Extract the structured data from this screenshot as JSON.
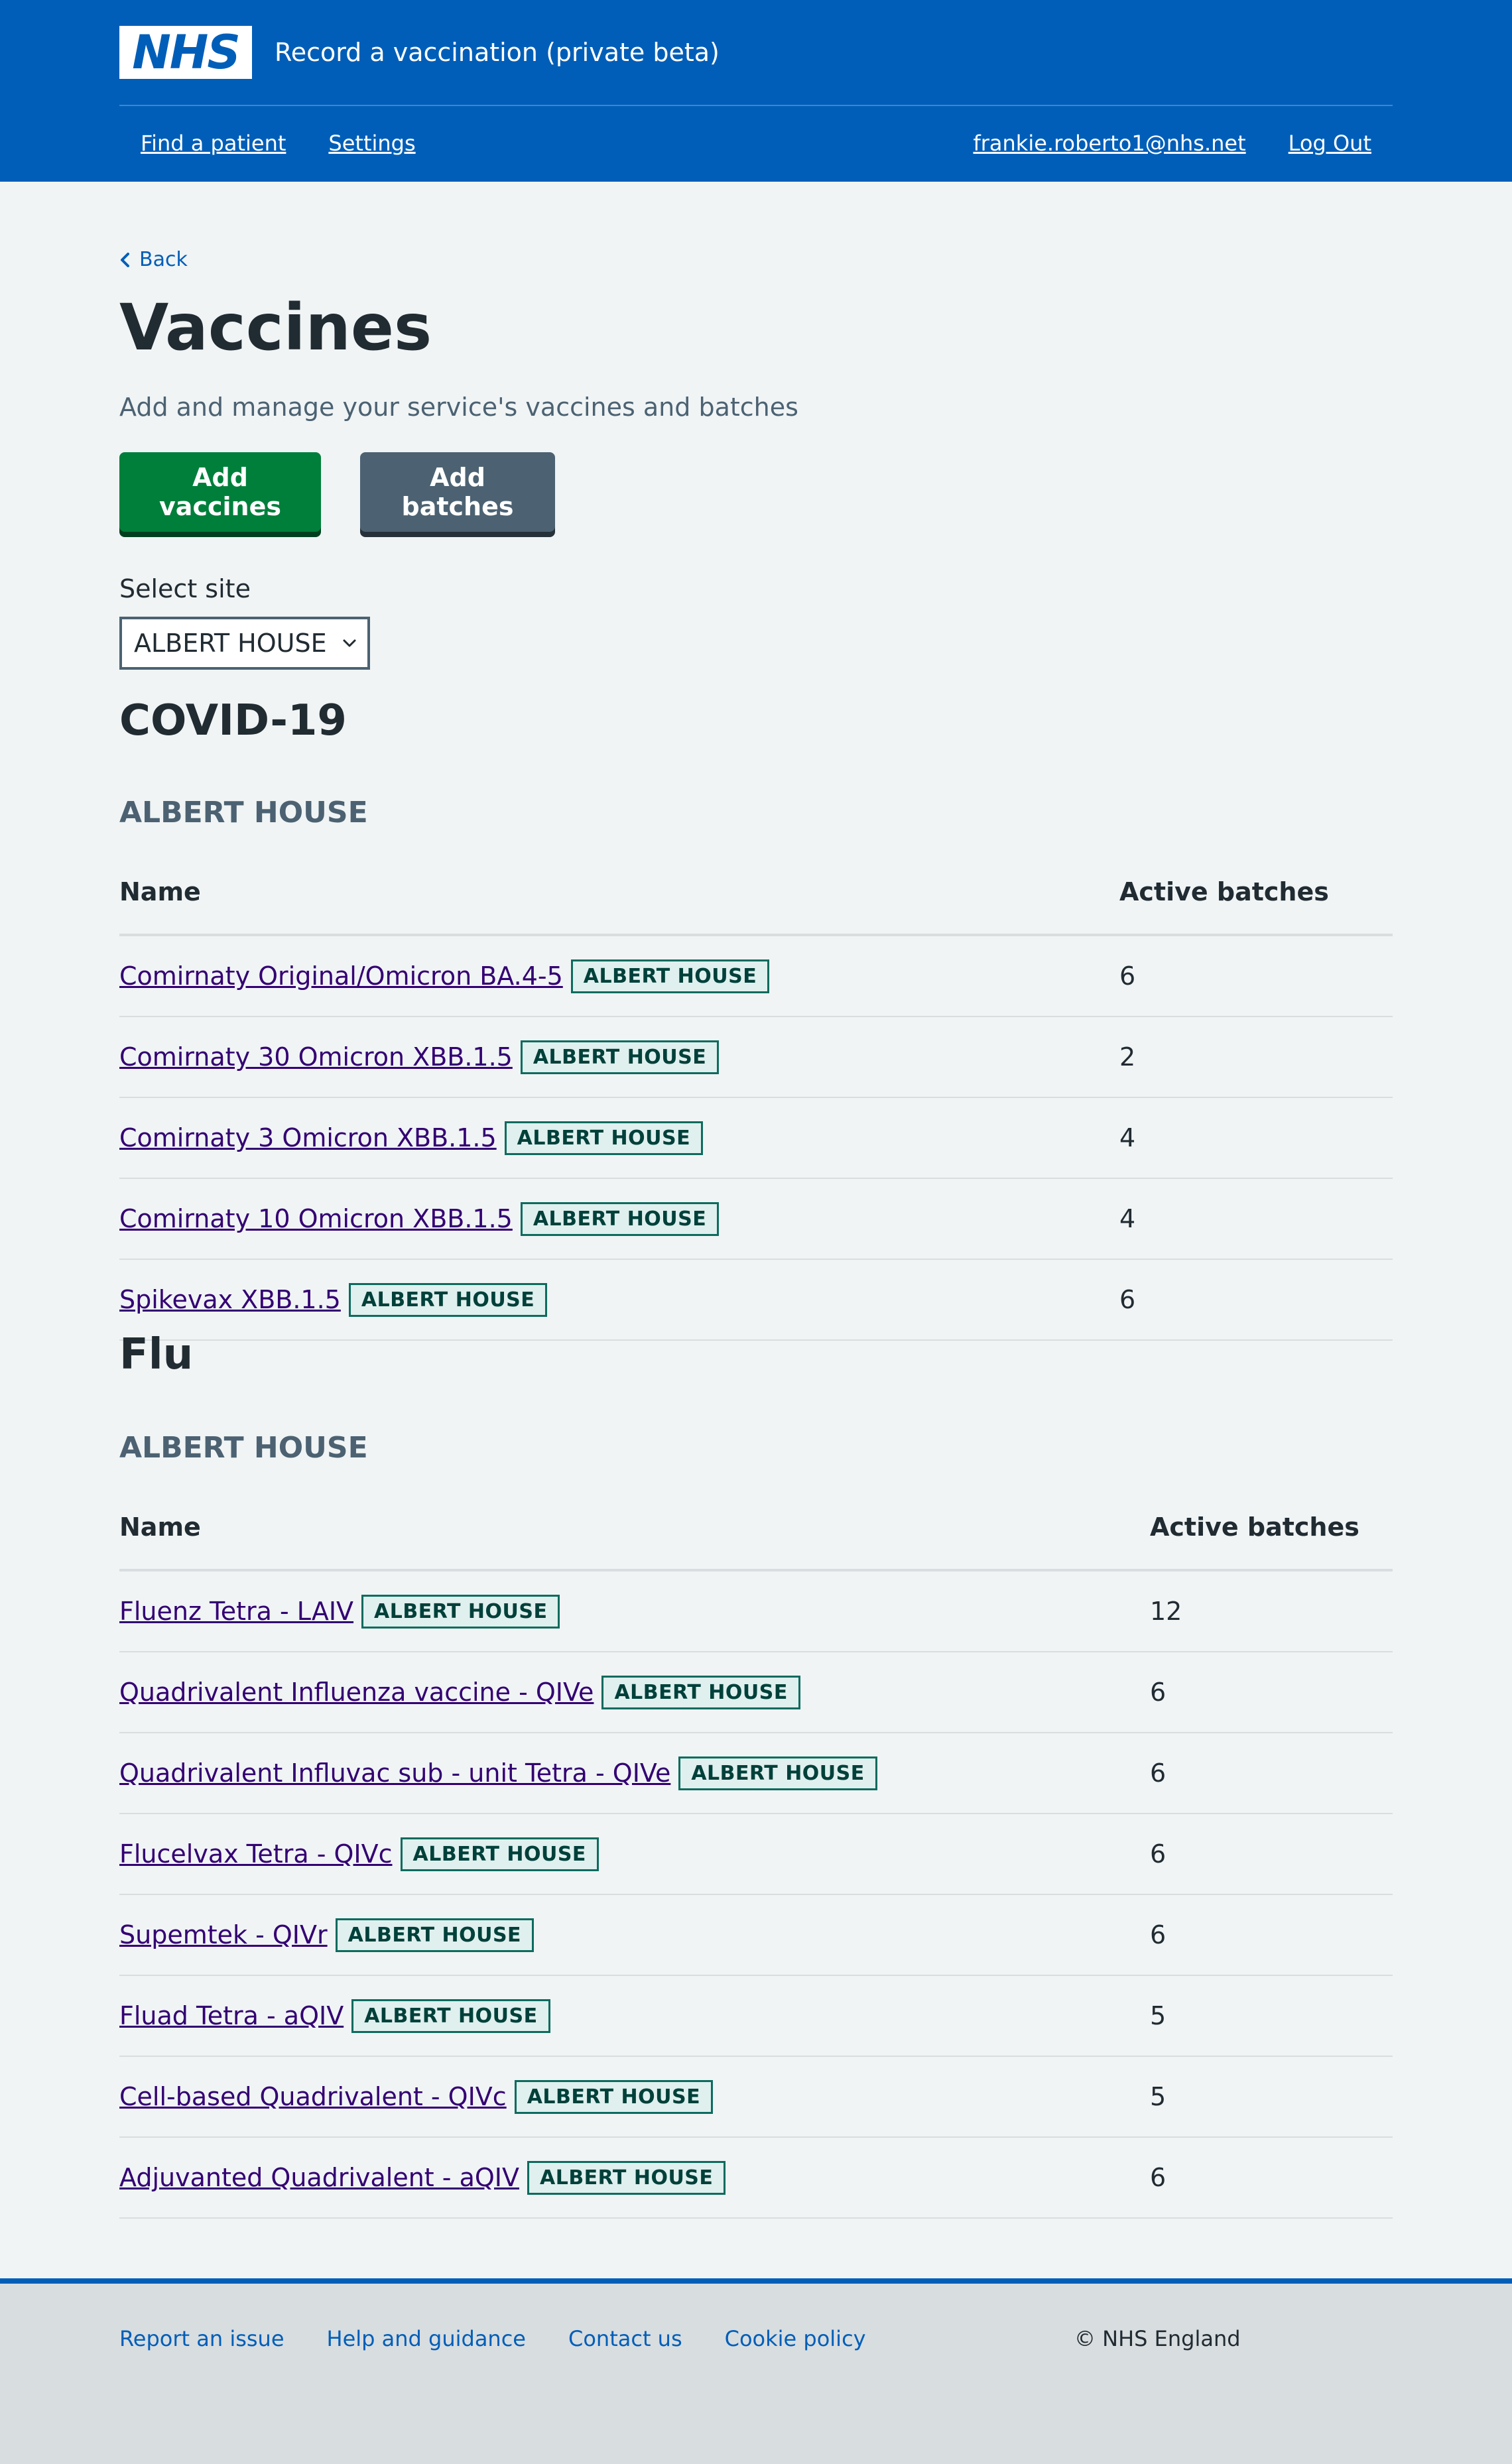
{
  "header": {
    "logo_text": "NHS",
    "service_name": "Record a vaccination (private beta)",
    "nav": {
      "find_patient": "Find a patient",
      "settings": "Settings",
      "user_email": "frankie.roberto1@nhs.net",
      "log_out": "Log Out"
    }
  },
  "page": {
    "back_label": "Back",
    "title": "Vaccines",
    "lede": "Add and manage your service's vaccines and batches",
    "add_vaccines_label": "Add vaccines",
    "add_batches_label": "Add batches",
    "select_site_label": "Select site",
    "selected_site": "ALBERT HOUSE"
  },
  "sections": {
    "covid": {
      "title": "COVID-19",
      "site_caption": "ALBERT HOUSE",
      "col_name": "Name",
      "col_batches": "Active batches",
      "rows": [
        {
          "name": "Comirnaty Original/Omicron BA.4-5",
          "tag": "ALBERT HOUSE",
          "batches": "6"
        },
        {
          "name": "Comirnaty 30 Omicron XBB.1.5",
          "tag": "ALBERT HOUSE",
          "batches": "2"
        },
        {
          "name": "Comirnaty 3 Omicron XBB.1.5",
          "tag": "ALBERT HOUSE",
          "batches": "4"
        },
        {
          "name": "Comirnaty 10 Omicron XBB.1.5",
          "tag": "ALBERT HOUSE",
          "batches": "4"
        },
        {
          "name": "Spikevax XBB.1.5",
          "tag": "ALBERT HOUSE",
          "batches": "6"
        }
      ]
    },
    "flu": {
      "title": "Flu",
      "site_caption": "ALBERT HOUSE",
      "col_name": "Name",
      "col_batches": "Active batches",
      "rows": [
        {
          "name": "Fluenz Tetra - LAIV",
          "tag": "ALBERT HOUSE",
          "batches": "12"
        },
        {
          "name": "Quadrivalent Influenza vaccine - QIVe",
          "tag": "ALBERT HOUSE",
          "batches": "6"
        },
        {
          "name": "Quadrivalent Influvac sub - unit Tetra - QIVe",
          "tag": "ALBERT HOUSE",
          "batches": "6"
        },
        {
          "name": "Flucelvax Tetra - QIVc",
          "tag": "ALBERT HOUSE",
          "batches": "6"
        },
        {
          "name": "Supemtek - QIVr",
          "tag": "ALBERT HOUSE",
          "batches": "6"
        },
        {
          "name": "Fluad Tetra - aQIV",
          "tag": "ALBERT HOUSE",
          "batches": "5"
        },
        {
          "name": "Cell-based Quadrivalent - QIVc",
          "tag": "ALBERT HOUSE",
          "batches": "5"
        },
        {
          "name": "Adjuvanted Quadrivalent - aQIV",
          "tag": "ALBERT HOUSE",
          "batches": "6"
        }
      ]
    }
  },
  "footer": {
    "links": [
      "Report an issue",
      "Help and guidance",
      "Contact us",
      "Cookie policy"
    ],
    "copyright": "© NHS England"
  }
}
